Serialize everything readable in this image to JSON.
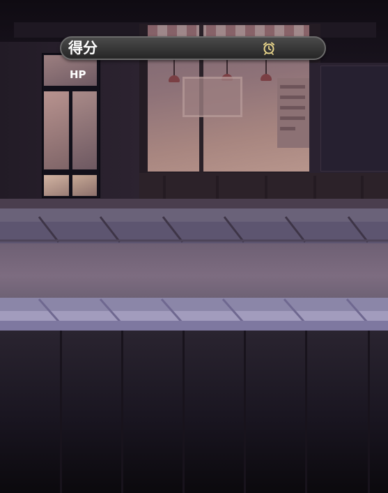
{
  "hud": {
    "score_label": "得分",
    "timer_icon": "alarm-clock-icon",
    "hp_label": "HP"
  },
  "colors": {
    "hud_bar": "#363636",
    "hud_border": "#6b6b6b",
    "timer_icon": "#e8d58a",
    "hud_text": "#ffffff"
  }
}
